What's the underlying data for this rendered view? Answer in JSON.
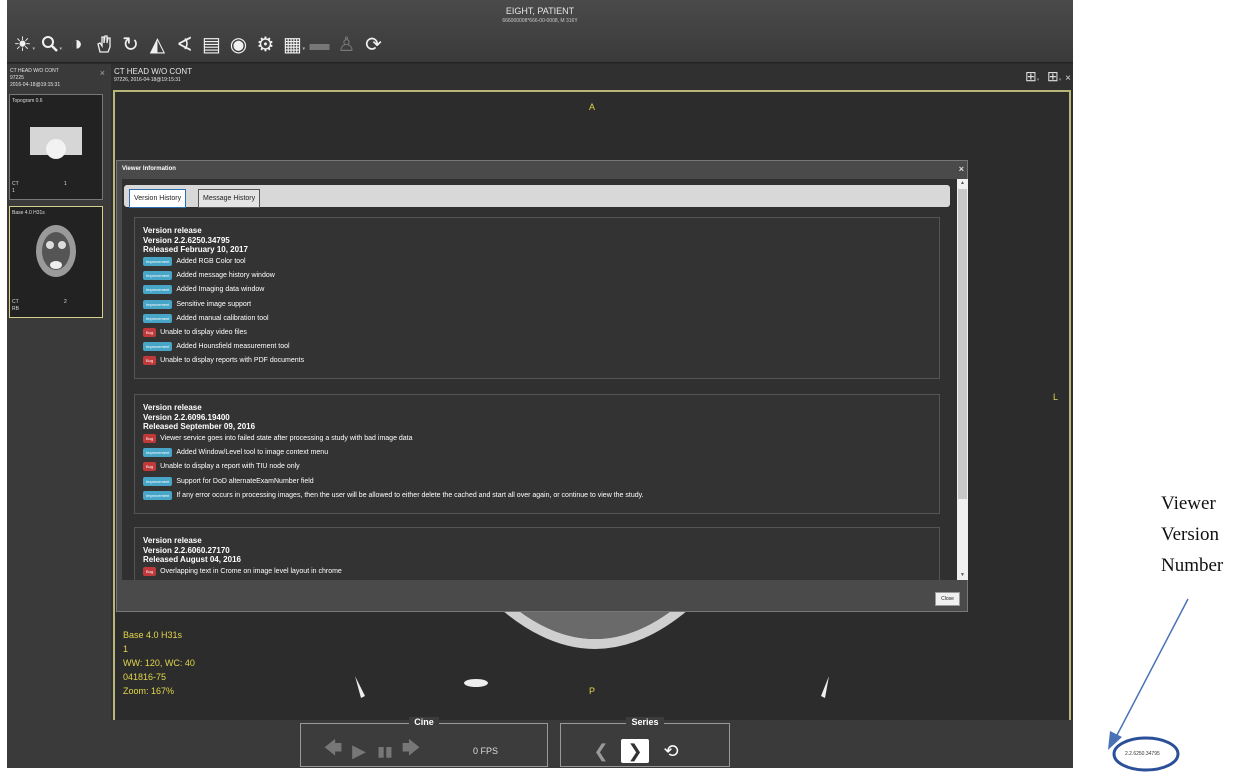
{
  "patient": {
    "name": "EIGHT, PATIENT",
    "id": "666000008*666-00-0008, M 316Y"
  },
  "toolbar": {
    "icons": [
      "sun-icon",
      "magnifier-icon",
      "contrast-icon",
      "hand-icon",
      "rotate-icon",
      "ruler-icon",
      "angle-icon",
      "document-icon",
      "eye-icon",
      "gear-icon",
      "grid-icon",
      "line-icon",
      "person-icon",
      "reset-icon"
    ]
  },
  "left_panel": {
    "study_title": "CT HEAD W/O CONT",
    "study_id": "97225",
    "study_date": "2016-04-18@19:15:31",
    "thumbs": [
      {
        "title": "Topogram 0.6",
        "bottom_left": "CT",
        "bottom_center": "1",
        "bottom_left2": "1"
      },
      {
        "title": "Base 4.0 H31s",
        "bottom_left": "CT",
        "bottom_center": "2",
        "bottom_left2": "RB"
      }
    ]
  },
  "viewer": {
    "title": "CT HEAD W/O CONT",
    "subtitle": "97226, 2016-04-18@19:15:31",
    "orient_top": "A",
    "orient_right": "L",
    "orient_bottom": "P",
    "info": [
      "Base 4.0 H31s",
      "1",
      "WW: 120, WC: 40",
      "041816-75",
      "Zoom: 167%"
    ]
  },
  "modal": {
    "title": "Viewer Information",
    "tabs": [
      "Version History",
      "Message History"
    ],
    "close_label": "Close",
    "releases": [
      {
        "h1": "Version release",
        "h2": "Version 2.2.6250.34795",
        "h3": "Released February 10, 2017",
        "items": [
          {
            "type": "Improvement",
            "text": "Added RGB Color tool"
          },
          {
            "type": "Improvement",
            "text": "Added message history window"
          },
          {
            "type": "Improvement",
            "text": "Added Imaging data window"
          },
          {
            "type": "Improvement",
            "text": "Sensitive image support"
          },
          {
            "type": "Improvement",
            "text": "Added manual calibration tool"
          },
          {
            "type": "Bug",
            "text": "Unable to display video files"
          },
          {
            "type": "Improvement",
            "text": "Added Hounsfield measurement tool"
          },
          {
            "type": "Bug",
            "text": "Unable to display reports with PDF documents"
          }
        ]
      },
      {
        "h1": "Version release",
        "h2": "Version 2.2.6096.19400",
        "h3": "Released September 09, 2016",
        "items": [
          {
            "type": "Bug",
            "text": "Viewer service goes into failed state after processing a study with bad image data"
          },
          {
            "type": "Improvement",
            "text": "Added Window/Level tool to image context menu"
          },
          {
            "type": "Bug",
            "text": "Unable to display a report with TIU node only"
          },
          {
            "type": "Improvement",
            "text": "Support for DoD alternateExamNumber field"
          },
          {
            "type": "Improvement",
            "text": "If any error occurs in processing images, then the user will be allowed to either delete the cached and start all over again, or continue to view the study."
          }
        ]
      },
      {
        "h1": "Version release",
        "h2": "Version 2.2.6060.27170",
        "h3": "Released August 04, 2016",
        "items": [
          {
            "type": "Bug",
            "text": "Overlapping text in Crome on image level layout in chrome"
          }
        ]
      }
    ]
  },
  "cine": {
    "label": "Cine",
    "fps": "0 FPS"
  },
  "series": {
    "label": "Series"
  },
  "version_number": "2.2.6250.34795",
  "annotation": {
    "line1": "Viewer",
    "line2": "Version",
    "line3": "Number"
  }
}
